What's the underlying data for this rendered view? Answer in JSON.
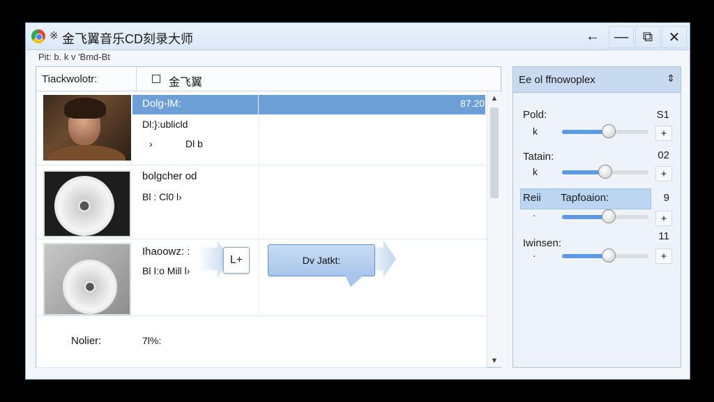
{
  "window": {
    "title_glyph": "※",
    "title": "金飞翼音乐CD刻录大师",
    "buttons": {
      "back": "←",
      "minimize": "—",
      "maximize": "⧉",
      "close": "✕"
    }
  },
  "breadcrumb": "Pit:  b.    k v 'Bmd-Bt",
  "list": {
    "header_left": "Tiackwolotr:",
    "header_right": "金飞翼",
    "rows": [
      {
        "title": "Dolg-lM:",
        "extra": "87.20",
        "sub1": "Dl:}:ublicld",
        "sub2a": "›",
        "sub2b": "Dl b",
        "selected": true
      },
      {
        "title": "bolgcher od",
        "sub1": "Bl : Cl0 l›",
        "selected": false
      },
      {
        "title": "Ihaoowz: :",
        "sub1": "Bl I:o Mill l›",
        "selected": false
      },
      {
        "title": "Nolier:",
        "extra": "7l%:",
        "selected": false
      }
    ]
  },
  "drag": {
    "handle_label": "L+",
    "tooltip": "Dv Jatkt:"
  },
  "side_panel": {
    "title": "Ee ol ffnowoplex",
    "toggle": "⇕",
    "controls": [
      {
        "label": "Pold:",
        "value": "S1",
        "sub": "k",
        "level": 0.54,
        "highlight": false
      },
      {
        "label": "Tatain:",
        "value": "02",
        "sub": "k",
        "level": 0.5,
        "highlight": false
      },
      {
        "label": "Reii",
        "label2": "Tapfoaion:",
        "value": "9",
        "sub": "·",
        "level": 0.54,
        "highlight": true
      },
      {
        "label": "Iwinsen:",
        "value": "11",
        "sub": "·",
        "level": 0.54,
        "highlight": false
      }
    ],
    "plus_label": "+"
  }
}
